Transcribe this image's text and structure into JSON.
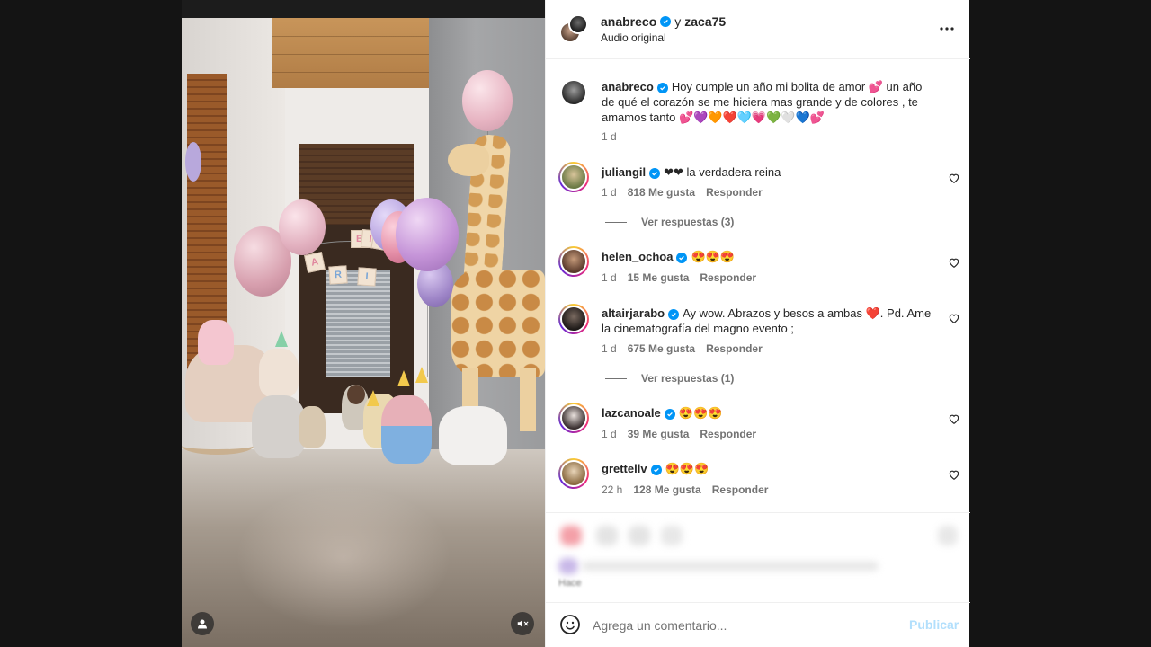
{
  "post": {
    "author": "anabreco",
    "connector": "y",
    "coauthor": "zaca75",
    "audio": "Audio original",
    "more_icon": "more-horizontal-icon"
  },
  "caption": {
    "user": "anabreco",
    "text": "Hoy cumple un año mi bolita de amor 💕 un año de qué el corazón se me hiciera mas grande y de colores , te amamos tanto 💕💜🧡❤️🩵💗💚🤍💙💕",
    "time": "1 d"
  },
  "comments": [
    {
      "user": "juliangil",
      "text": "❤❤ la verdadera reina",
      "time": "1 d",
      "likes": "818 Me gusta",
      "reply": "Responder",
      "view_replies": "Ver respuestas (3)"
    },
    {
      "user": "helen_ochoa",
      "text": "😍😍😍",
      "time": "1 d",
      "likes": "15 Me gusta",
      "reply": "Responder"
    },
    {
      "user": "altairjarabo",
      "text": "Ay wow. Abrazos y besos a ambas ❤️. Pd. Ame la cinematografía del magno evento ;",
      "time": "1 d",
      "likes": "675 Me gusta",
      "reply": "Responder",
      "view_replies": "Ver respuestas (1)"
    },
    {
      "user": "lazcanoale",
      "text": "😍😍😍",
      "time": "1 d",
      "likes": "39 Me gusta",
      "reply": "Responder"
    },
    {
      "user": "grettellv",
      "text": "😍😍😍",
      "time": "22 h",
      "likes": "128 Me gusta",
      "reply": "Responder"
    }
  ],
  "banner_letters": [
    "B",
    "I",
    "R",
    "A",
    "R",
    "I"
  ],
  "blurred_footer": {
    "time_fragment": "Hace"
  },
  "add_comment": {
    "placeholder": "Agrega un comentario...",
    "publish_label": "Publicar",
    "emoji_icon": "smiley-icon"
  },
  "media_controls": {
    "tag_icon": "user-tag-icon",
    "mute_icon": "speaker-muted-icon"
  },
  "colors": {
    "verified": "#0095f6",
    "publish_disabled": "#b2dffc",
    "secondary_text": "#737373"
  }
}
